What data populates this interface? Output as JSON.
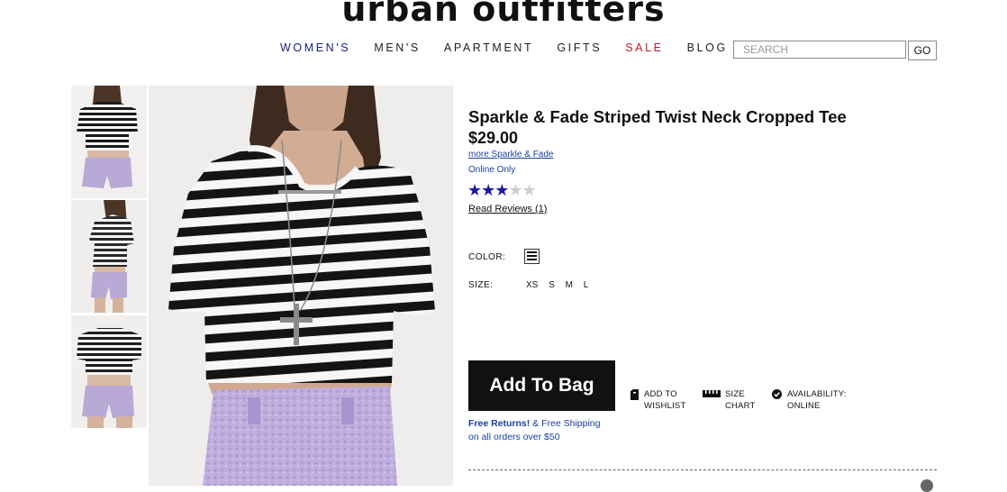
{
  "header": {
    "logo": "urban outfitters",
    "nav": [
      "WOMEN'S",
      "MEN'S",
      "APARTMENT",
      "GIFTS",
      "SALE",
      "BLOG"
    ],
    "search_placeholder": "SEARCH",
    "go_label": "GO"
  },
  "product": {
    "title": "Sparkle & Fade Striped Twist Neck Cropped Tee",
    "price": "$29.00",
    "more_link": "more Sparkle & Fade",
    "availability_note": "Online Only",
    "rating": 3,
    "rating_max": 5,
    "reviews_link": "Read Reviews (1)",
    "color_label": "COLOR:",
    "size_label": "SIZE:",
    "sizes": [
      "XS",
      "S",
      "M",
      "L"
    ],
    "add_to_bag": "Add To Bag",
    "wishlist": [
      "ADD TO",
      "WISHLIST"
    ],
    "size_chart": [
      "SIZE",
      "CHART"
    ],
    "availability": [
      "AVAILABILITY:",
      "ONLINE"
    ],
    "returns_link": "Free Returns!",
    "returns_rest": " & Free Shipping",
    "returns_line2": "on all orders over $50"
  },
  "colors": {
    "nav_accent": "#1a237e",
    "sale": "#c0172f",
    "link": "#1a3fa0",
    "star": "#1a1a9e",
    "button": "#111111"
  },
  "icons": [
    "wishlist-tag-icon",
    "ruler-icon",
    "checkmark-circle-icon",
    "expand-icon"
  ]
}
